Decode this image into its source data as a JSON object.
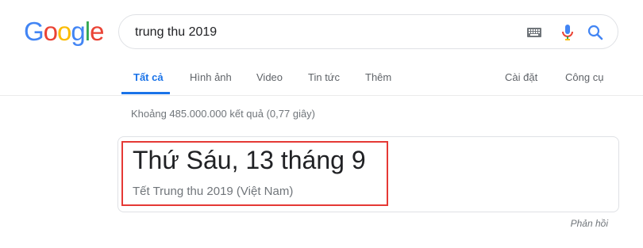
{
  "logo": {
    "letters": [
      "G",
      "o",
      "o",
      "g",
      "l",
      "e"
    ],
    "colors": [
      "#4285F4",
      "#EA4335",
      "#FBBC05",
      "#4285F4",
      "#34A853",
      "#EA4335"
    ]
  },
  "search": {
    "query": "trung thu 2019",
    "icons": [
      "keyboard-icon",
      "mic-icon",
      "search-icon"
    ]
  },
  "tabs": {
    "all": "Tất cả",
    "images": "Hình ảnh",
    "video": "Video",
    "news": "Tin tức",
    "more": "Thêm",
    "settings": "Cài đặt",
    "tools": "Công cụ"
  },
  "result_stats": "Khoảng 485.000.000 kết quả (0,77 giây)",
  "answer": {
    "date": "Thứ Sáu, 13 tháng 9",
    "subtitle": "Tết Trung thu 2019 (Việt Nam)"
  },
  "feedback": "Phản hồi",
  "colors": {
    "accent": "#1a73e8",
    "highlight_border": "#e53935"
  }
}
